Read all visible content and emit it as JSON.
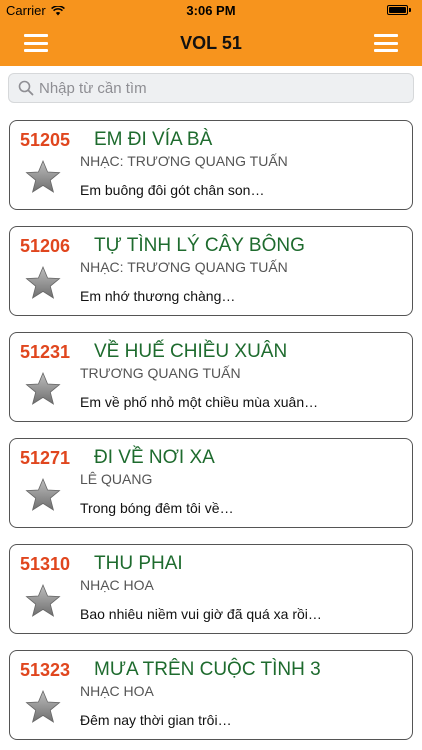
{
  "status_bar": {
    "carrier": "Carrier",
    "time": "3:06 PM"
  },
  "nav": {
    "title": "VOL 51",
    "left_icon": "hamburger-menu-icon",
    "right_icon": "hamburger-menu-icon"
  },
  "search": {
    "placeholder": "Nhập từ cần tìm",
    "icon": "search-icon"
  },
  "colors": {
    "header_bg": "#f7941d",
    "song_id": "#e0461e",
    "song_title": "#1e6b2e"
  },
  "songs": [
    {
      "id": "51205",
      "title": "EM ĐI VÍA BÀ",
      "artist": "NHẠC: TRƯƠNG QUANG TUẤN",
      "lyric": "Em buông đôi gót chân son…",
      "favorite_icon": "star-icon"
    },
    {
      "id": "51206",
      "title": "TỰ TÌNH LÝ CÂY BÔNG",
      "artist": "NHẠC: TRƯƠNG QUANG TUẤN",
      "lyric": "Em nhớ thương chàng…",
      "favorite_icon": "star-icon"
    },
    {
      "id": "51231",
      "title": "VỀ HUẾ CHIỀU XUÂN",
      "artist": "TRƯƠNG QUANG TUẤN",
      "lyric": "Em về phố nhỏ một chiều mùa xuân…",
      "favorite_icon": "star-icon"
    },
    {
      "id": "51271",
      "title": "ĐI VỀ NƠI XA",
      "artist": "LÊ QUANG",
      "lyric": "Trong bóng đêm tôi về…",
      "favorite_icon": "star-icon"
    },
    {
      "id": "51310",
      "title": "THU PHAI",
      "artist": "NHẠC HOA",
      "lyric": "Bao nhiêu niềm vui giờ đã quá xa rồi…",
      "favorite_icon": "star-icon"
    },
    {
      "id": "51323",
      "title": "MƯA TRÊN CUỘC TÌNH 3",
      "artist": "NHẠC HOA",
      "lyric": "Đêm nay thời gian trôi…",
      "favorite_icon": "star-icon"
    }
  ]
}
